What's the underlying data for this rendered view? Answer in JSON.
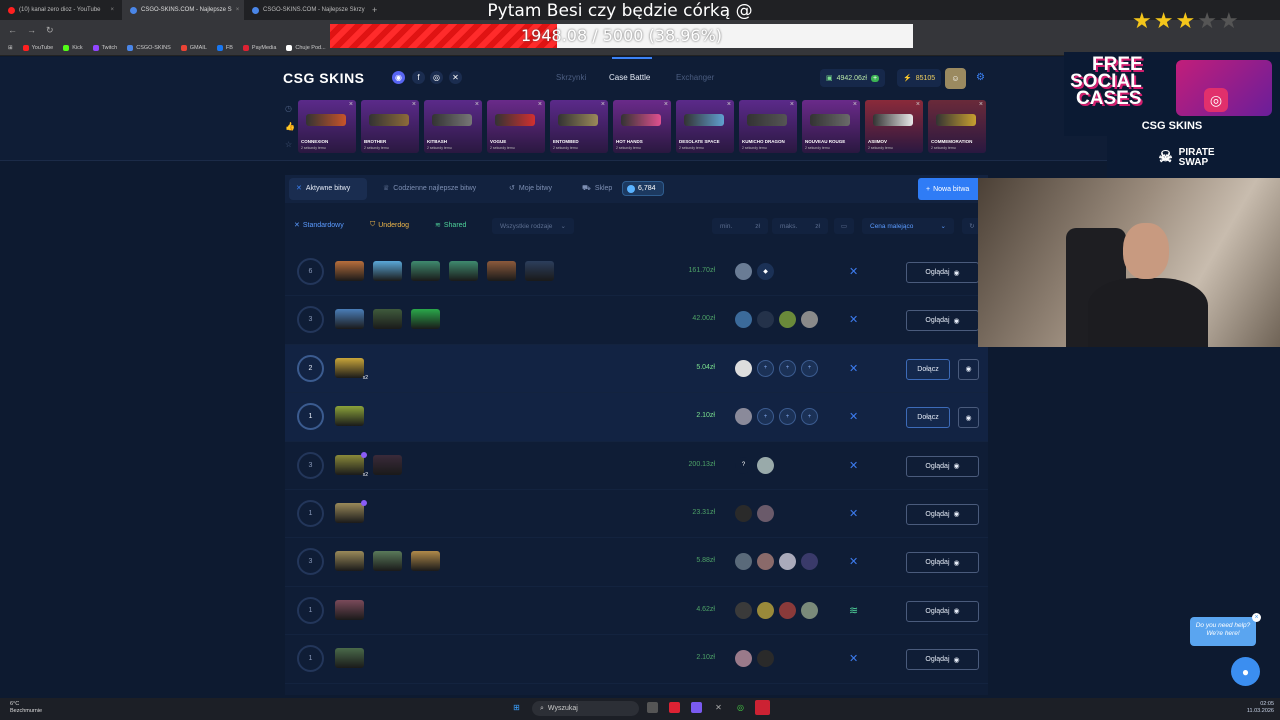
{
  "browser": {
    "tabs": [
      {
        "label": "(10) kanał zero dioz - YouTube",
        "color": "#ff2020"
      },
      {
        "label": "CSGO-SKINS.COM - Najlepsze S",
        "color": "#4a86e8",
        "active": true
      },
      {
        "label": "CSGO-SKINS.COM - Najlepsze Skrzy",
        "color": "#4a86e8"
      }
    ],
    "bookmarks": [
      "YouTube",
      "Kick",
      "Twitch",
      "CSGO-SKINS",
      "GMAIL",
      "FB",
      "PayMedia",
      "Chuje Pod..."
    ]
  },
  "stream": {
    "title": "Pytam Besi czy będzie córką @",
    "goal_text": "1948.08 / 5000 (38.96%)",
    "goal_fraction": 0.3896,
    "stars_filled": 3,
    "stars_total": 5
  },
  "site": {
    "logo": "CSG SKINS",
    "nav": [
      "Skrzynki",
      "Case Battle",
      "Exchanger"
    ],
    "balance": "4942.06zł",
    "points": "85105"
  },
  "drops": [
    {
      "name": "CONNEXION",
      "sub": "2 sekundy temu",
      "bg": "#5b2a8a",
      "gun": "#c8542a"
    },
    {
      "name": "BROTHER",
      "sub": "2 sekundy temu",
      "bg": "#5b2a8a",
      "gun": "#8d6b3a"
    },
    {
      "name": "KITBASH",
      "sub": "2 sekundy temu",
      "bg": "#5b2a8a",
      "gun": "#777777"
    },
    {
      "name": "VOGUE",
      "sub": "2 sekundy temu",
      "bg": "#6a2a8a",
      "gun": "#d23030"
    },
    {
      "name": "ENTOMBED",
      "sub": "2 sekundy temu",
      "bg": "#5b2a8a",
      "gun": "#9b8a5a"
    },
    {
      "name": "HOT HANDS",
      "sub": "2 sekundy temu",
      "bg": "#6a2a8a",
      "gun": "#e05090"
    },
    {
      "name": "DESOLATE SPACE",
      "sub": "2 sekundy temu",
      "bg": "#5b2a8a",
      "gun": "#60a0d0"
    },
    {
      "name": "KUMICHO DRAGON",
      "sub": "2 sekundy temu",
      "bg": "#5b2a8a",
      "gun": "#555555"
    },
    {
      "name": "NOUVEAU ROUGE",
      "sub": "2 sekundy temu",
      "bg": "#6a2a8a",
      "gun": "#6a6a6a"
    },
    {
      "name": "ASIIMOV",
      "sub": "2 sekundy temu",
      "bg": "#8a2a3a",
      "gun": "#e8e8e8"
    },
    {
      "name": "COMMEMORATION",
      "sub": "2 sekundy temu",
      "bg": "#6a2a3a",
      "gun": "#c8a030"
    }
  ],
  "tabs": {
    "active": "Aktywne bitwy",
    "daily": "Codzienne najlepsze bitwy",
    "mine": "Moje bitwy",
    "shop": "Sklep",
    "coins": "6,784",
    "new_battle": "Nowa bitwa"
  },
  "filters": {
    "standard": "Standardowy",
    "underdog": "Underdog",
    "shared": "Shared",
    "all_types": "Wszystkie rodzaje",
    "min": "min.",
    "max": "maks.",
    "currency": "zł",
    "sort": "Cena malejąco"
  },
  "battles": [
    {
      "rounds": "6",
      "price": "161.70zł",
      "cases": [
        "#b76e3c",
        "#5aa7d8",
        "#3f8a6e",
        "#3f8a6e",
        "#8c5a3c",
        "#2c3e5c"
      ],
      "players": [
        {
          "c": "#6a7c95"
        },
        {
          "c": "#1b3156",
          "t": "◆"
        }
      ],
      "action": "Oglądaj"
    },
    {
      "rounds": "3",
      "price": "42.00zł",
      "cases": [
        "#4a7eb8",
        "#3f5a3c",
        "#2aa84a"
      ],
      "players": [
        {
          "c": "#3b6a9a"
        },
        {
          "c": "#24324a"
        },
        {
          "c": "#6a8a3a"
        },
        {
          "c": "#8a8a8a"
        }
      ],
      "action": "Oglądaj"
    },
    {
      "rounds": "2",
      "price": "5.04zł",
      "cases": [
        "#c9a53a"
      ],
      "mult": "x2",
      "players": [
        {
          "c": "#dddddd"
        },
        {
          "add": true
        },
        {
          "add": true
        },
        {
          "add": true
        }
      ],
      "action": "Dołącz",
      "highlight": true
    },
    {
      "rounds": "1",
      "price": "2.10zł",
      "cases": [
        "#8ba23a"
      ],
      "players": [
        {
          "c": "#8a8a9a"
        },
        {
          "add": true
        },
        {
          "add": true
        },
        {
          "add": true
        }
      ],
      "action": "Dołącz",
      "highlight": true
    },
    {
      "rounds": "3",
      "price": "200.13zł",
      "cases": [
        "#8a8a3a",
        "#3a2a3a"
      ],
      "mult": "x2",
      "dot": true,
      "players": [
        {
          "c": "#0f1d36",
          "t": "?"
        },
        {
          "c": "#9aa"
        }
      ],
      "action": "Oglądaj"
    },
    {
      "rounds": "1",
      "price": "23.31zł",
      "cases": [
        "#9a8a5a"
      ],
      "dot": true,
      "players": [
        {
          "c": "#2a2a2a"
        },
        {
          "c": "#6a5a6a"
        }
      ],
      "action": "Oglądaj"
    },
    {
      "rounds": "3",
      "price": "5.88zł",
      "cases": [
        "#9a8a5a",
        "#5a7a5a",
        "#b08a4a"
      ],
      "players": [
        {
          "c": "#5a6a7a"
        },
        {
          "c": "#8a6a6a"
        },
        {
          "c": "#aab"
        },
        {
          "c": "#3a3a6a"
        }
      ],
      "action": "Oglądaj"
    },
    {
      "rounds": "1",
      "price": "4.62zł",
      "cases": [
        "#7a4a5a"
      ],
      "players": [
        {
          "c": "#3a3a3a"
        },
        {
          "c": "#9a8a3a"
        },
        {
          "c": "#8a3a3a"
        },
        {
          "c": "#7a8a7a"
        }
      ],
      "action": "Oglądaj",
      "modeIcon": "≋"
    },
    {
      "rounds": "1",
      "price": "2.10zł",
      "cases": [
        "#4a6a4a"
      ],
      "players": [
        {
          "c": "#9a7a8a"
        },
        {
          "c": "#2a2a2a"
        }
      ],
      "action": "Oglądaj"
    }
  ],
  "overlay": {
    "promo_line1": "FREE",
    "promo_line2": "SOCIAL",
    "promo_line3": "CASES",
    "promo_brand": "CSG SKINS",
    "pirate": "PIRATE SWAP"
  },
  "help": {
    "text": "Do you need help? We're here!"
  },
  "taskbar": {
    "weather_temp": "6°C",
    "weather_desc": "Bezchmurnie",
    "search": "Wyszukaj",
    "time": "02:05",
    "date": "11.03.2026"
  }
}
